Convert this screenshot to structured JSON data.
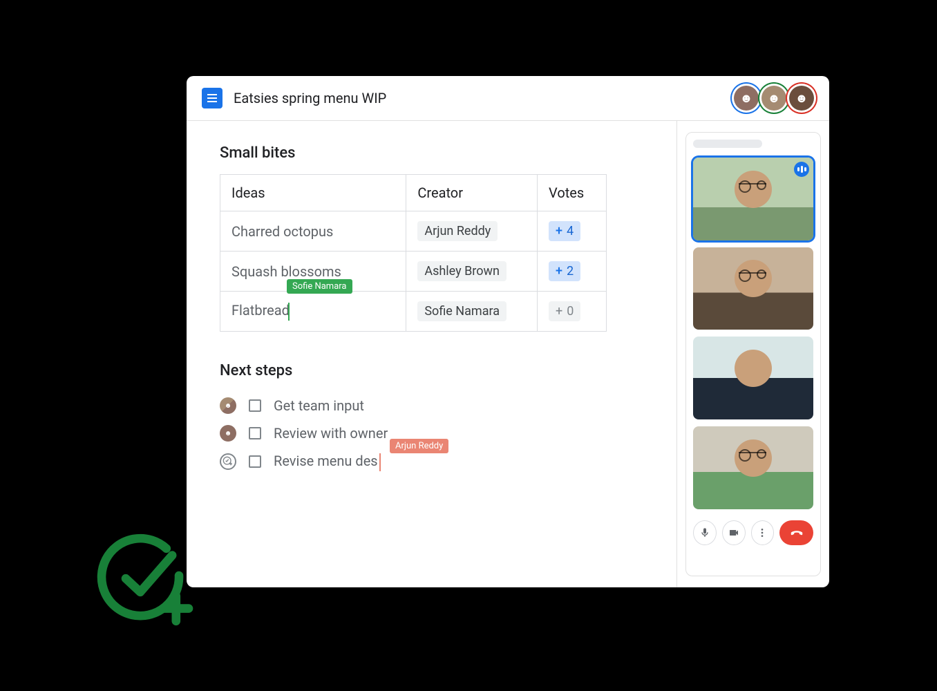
{
  "header": {
    "doc_title": "Eatsies spring menu WIP",
    "collaborators": [
      {
        "name": "Collaborator 1",
        "ring_color": "#1a73e8"
      },
      {
        "name": "Collaborator 2",
        "ring_color": "#188038"
      },
      {
        "name": "Collaborator 3",
        "ring_color": "#d93025"
      }
    ]
  },
  "sections": {
    "small_bites": {
      "heading": "Small bites",
      "columns": {
        "ideas": "Ideas",
        "creator": "Creator",
        "votes": "Votes"
      },
      "rows": [
        {
          "idea": "Charred octopus",
          "creator": "Arjun Reddy",
          "votes": 4,
          "vote_style": "active"
        },
        {
          "idea": "Squash blossoms",
          "creator": "Ashley Brown",
          "votes": 2,
          "vote_style": "active"
        },
        {
          "idea": "Flatbread",
          "creator": "Sofie Namara",
          "votes": 0,
          "vote_style": "zero",
          "cursor_user": "Sofie Namara",
          "cursor_color": "green"
        }
      ]
    },
    "next_steps": {
      "heading": "Next steps",
      "items": [
        {
          "text": "Get team input",
          "assignee_kind": "group",
          "checked": false
        },
        {
          "text": "Review with owner",
          "assignee_kind": "single",
          "checked": false
        },
        {
          "text": "Revise menu des",
          "assignee_kind": "taskplus",
          "checked": false,
          "cursor_user": "Arjun Reddy",
          "cursor_color": "red"
        }
      ]
    }
  },
  "meet": {
    "participants": [
      {
        "id": "p1",
        "speaking": true,
        "wears_glasses": true
      },
      {
        "id": "p2",
        "speaking": false,
        "wears_glasses": true
      },
      {
        "id": "p3",
        "speaking": false,
        "wears_glasses": false
      },
      {
        "id": "p4",
        "speaking": false,
        "wears_glasses": true
      }
    ],
    "controls": {
      "mic": "mic",
      "camera": "camera",
      "more": "more",
      "hangup": "hangup"
    }
  },
  "cursor_labels": {
    "sofie": "Sofie Namara",
    "arjun": "Arjun Reddy"
  },
  "vote_plus": "+"
}
